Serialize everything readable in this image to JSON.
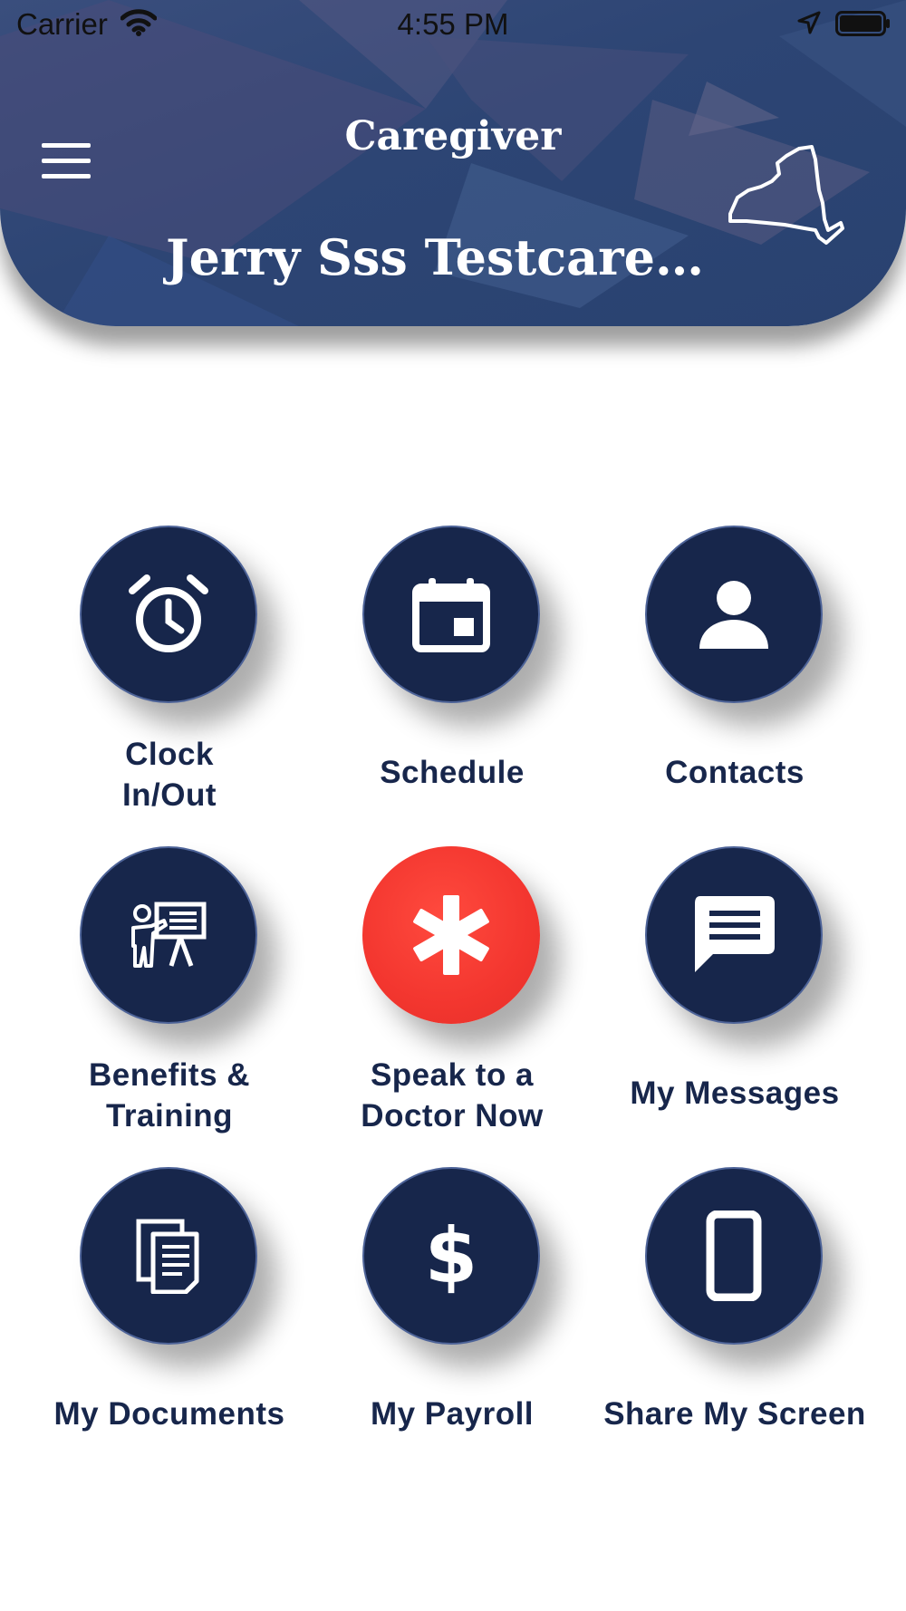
{
  "status_bar": {
    "carrier": "Carrier",
    "time": "4:55 PM"
  },
  "header": {
    "app_title": "Caregiver",
    "user_name": "Jerry Sss Testcare…",
    "menu_icon": "hamburger-menu-icon",
    "state_icon": "new-york-state-outline-icon"
  },
  "colors": {
    "header_bg": "#2d4574",
    "tile_bg": "#17264b",
    "tile_border": "#4d6398",
    "accent_red": "#f3362f",
    "label_text": "#17264b"
  },
  "tiles": [
    {
      "line1": "Clock",
      "line2": "In/Out",
      "icon": "alarm-clock-icon"
    },
    {
      "line1": "Schedule",
      "line2": "",
      "icon": "calendar-icon"
    },
    {
      "line1": "Contacts",
      "line2": "",
      "icon": "person-icon"
    },
    {
      "line1": "Benefits &",
      "line2": "Training",
      "icon": "training-presentation-icon"
    },
    {
      "line1": "Speak to a",
      "line2": "Doctor Now",
      "icon": "medical-asterisk-icon"
    },
    {
      "line1": "My Messages",
      "line2": "",
      "icon": "message-bubble-icon"
    },
    {
      "line1": "My Documents",
      "line2": "",
      "icon": "documents-icon"
    },
    {
      "line1": "My Payroll",
      "line2": "",
      "icon": "dollar-icon"
    },
    {
      "line1": "Share My Screen",
      "line2": "",
      "icon": "mobile-phone-icon"
    }
  ]
}
